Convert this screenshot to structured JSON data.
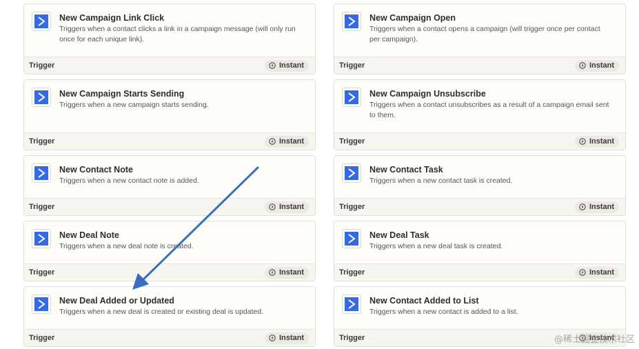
{
  "cards": [
    {
      "title": "New Campaign Link Click",
      "desc": "Triggers when a contact clicks a link in a campaign message (will only run once for each unique link).",
      "type": "Trigger",
      "badge": "Instant"
    },
    {
      "title": "New Campaign Open",
      "desc": "Triggers when a contact opens a campaign (will trigger once per contact per campaign).",
      "type": "Trigger",
      "badge": "Instant"
    },
    {
      "title": "New Campaign Starts Sending",
      "desc": "Triggers when a new campaign starts sending.",
      "type": "Trigger",
      "badge": "Instant"
    },
    {
      "title": "New Campaign Unsubscribe",
      "desc": "Triggers when a contact unsubscribes as a result of a campaign email sent to them.",
      "type": "Trigger",
      "badge": "Instant"
    },
    {
      "title": "New Contact Note",
      "desc": "Triggers when a new contact note is added.",
      "type": "Trigger",
      "badge": "Instant"
    },
    {
      "title": "New Contact Task",
      "desc": "Triggers when a new contact task is created.",
      "type": "Trigger",
      "badge": "Instant"
    },
    {
      "title": "New Deal Note",
      "desc": "Triggers when a new deal note is created.",
      "type": "Trigger",
      "badge": "Instant"
    },
    {
      "title": "New Deal Task",
      "desc": "Triggers when a new deal task is created.",
      "type": "Trigger",
      "badge": "Instant"
    },
    {
      "title": "New Deal Added or Updated",
      "desc": "Triggers when a new deal is created or existing deal is updated.",
      "type": "Trigger",
      "badge": "Instant"
    },
    {
      "title": "New Contact Added to List",
      "desc": "Triggers when a new contact is added to a list.",
      "type": "Trigger",
      "badge": "Instant"
    }
  ],
  "watermark": "@稀土掘金技术社区",
  "colors": {
    "icon_bg": "#356ae6",
    "card_bg": "#fffdf9",
    "footer_bg": "#f7f5f0",
    "badge_bg": "#ece9e2",
    "annotation_arrow": "#3a6dbf"
  },
  "icons": {
    "app_icon": "activecampaign-chevron-icon",
    "badge_icon": "lightning-bolt-icon"
  }
}
